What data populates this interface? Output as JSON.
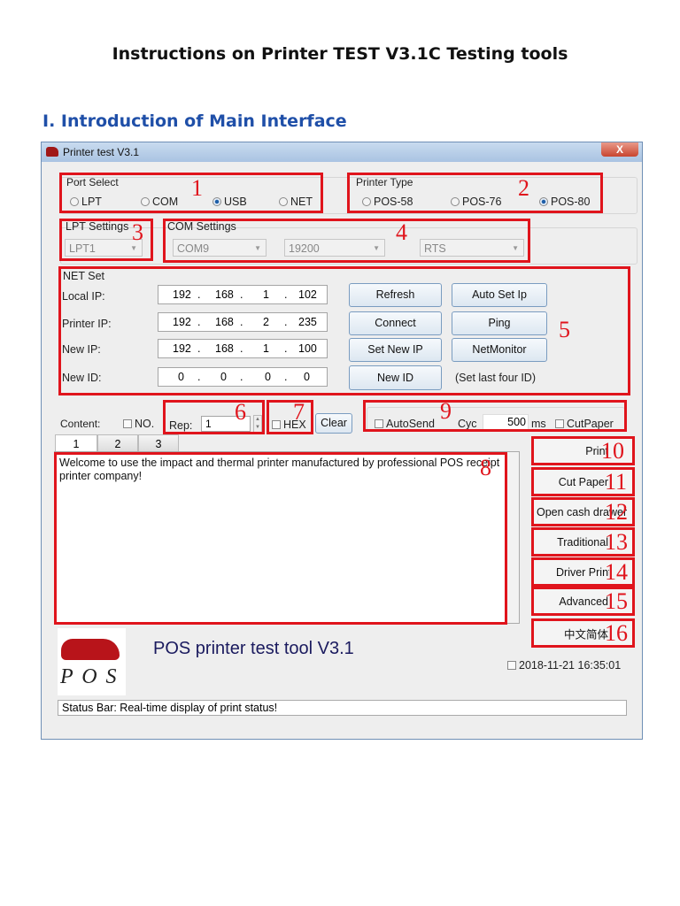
{
  "doc": {
    "title": "Instructions on Printer TEST V3.1C Testing tools",
    "heading": "I. Introduction of Main Interface"
  },
  "window": {
    "title": "Printer test V3.1",
    "close": "X"
  },
  "port_select": {
    "label": "Port Select",
    "options": [
      "LPT",
      "COM",
      "USB",
      "NET"
    ],
    "selected": "USB"
  },
  "printer_type": {
    "label": "Printer Type",
    "options": [
      "POS-58",
      "POS-76",
      "POS-80"
    ],
    "selected": "POS-80"
  },
  "lpt_settings": {
    "label": "LPT Settings",
    "value": "LPT1"
  },
  "com_settings": {
    "label": "COM Settings",
    "port": "COM9",
    "baud": "19200",
    "flow": "RTS"
  },
  "net_set": {
    "label": "NET Set",
    "rows": [
      {
        "label": "Local IP:",
        "ip": [
          "192",
          "168",
          "1",
          "102"
        ]
      },
      {
        "label": "Printer IP:",
        "ip": [
          "192",
          "168",
          "2",
          "235"
        ]
      },
      {
        "label": "New IP:",
        "ip": [
          "192",
          "168",
          "1",
          "100"
        ]
      },
      {
        "label": "New ID:",
        "ip": [
          "0",
          "0",
          "0",
          "0"
        ]
      }
    ],
    "buttons": [
      "Refresh",
      "Auto Set Ip",
      "Connect",
      "Ping",
      "Set New IP",
      "NetMonitor",
      "New ID"
    ],
    "hint": "(Set last four ID)"
  },
  "content": {
    "label": "Content:",
    "no_label": "NO.",
    "rep_label": "Rep:",
    "rep_value": "1",
    "hex_label": "HEX",
    "clear": "Clear",
    "autosend": "AutoSend",
    "cyc_label": "Cyc",
    "cyc_value": "500",
    "ms": "ms",
    "cutpaper": "CutPaper"
  },
  "tabs": [
    "1",
    "2",
    "3"
  ],
  "text": "Welcome to use the impact and thermal printer manufactured by professional POS receipt printer company!",
  "side_buttons": [
    "Print",
    "Cut Paper",
    "Open cash drawer",
    "Traditional",
    "Driver Print",
    "Advanced",
    "中文简体"
  ],
  "logo_text": "P O S",
  "app_title": "POS printer test tool V3.1",
  "datetime": "2018-11-21 16:35:01",
  "status": "Status Bar: Real-time display of print status!",
  "markers": [
    "1",
    "2",
    "3",
    "4",
    "5",
    "6",
    "7",
    "8",
    "9",
    "10",
    "11",
    "12",
    "13",
    "14",
    "15",
    "16"
  ]
}
